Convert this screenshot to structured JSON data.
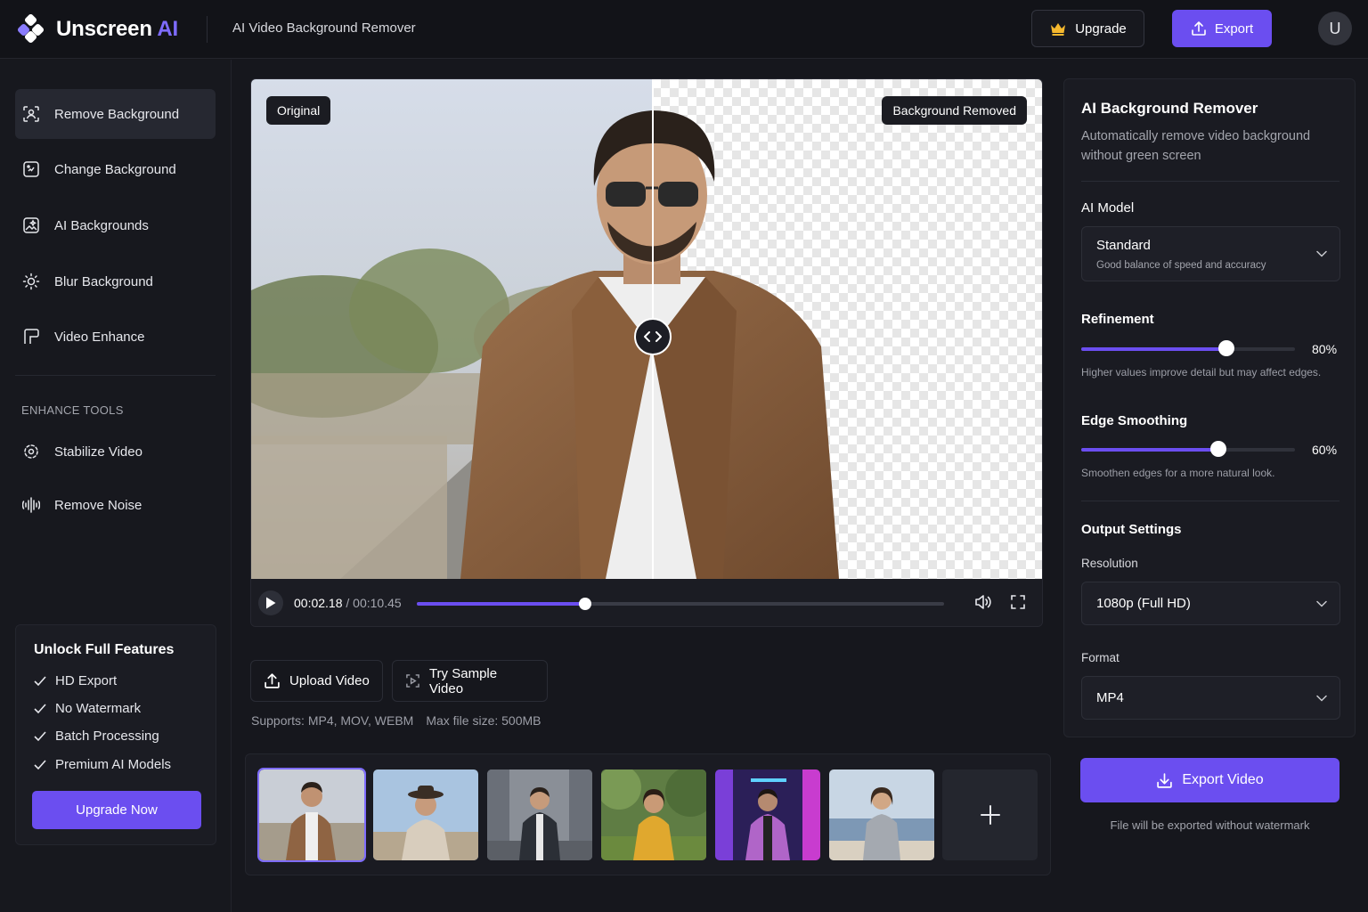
{
  "header": {
    "logo_name": "Unscreen ",
    "logo_ai": "AI",
    "page_title": "AI Video Background Remover",
    "upgrade_label": "Upgrade",
    "export_label": "Export",
    "avatar_initial": "U",
    "accent": "#6b4ef0"
  },
  "sidebar": {
    "items": [
      {
        "label": "Remove Background",
        "icon": "remove-bg-icon"
      },
      {
        "label": "Change Background",
        "icon": "change-bg-icon"
      },
      {
        "label": "AI Backgrounds",
        "icon": "ai-bg-icon"
      },
      {
        "label": "Blur Background",
        "icon": "blur-icon"
      },
      {
        "label": "Video Enhance",
        "icon": "enhance-icon"
      }
    ],
    "section_title": "ENHANCE TOOLS",
    "tools": [
      {
        "label": "Stabilize Video",
        "icon": "stabilize-icon"
      },
      {
        "label": "Remove Noise",
        "icon": "noise-icon"
      }
    ],
    "unlock": {
      "title": "Unlock Full Features",
      "features": [
        "HD Export",
        "No Watermark",
        "Batch Processing",
        "Premium AI Models"
      ],
      "button": "Upgrade Now"
    }
  },
  "preview": {
    "label_left": "Original",
    "label_right": "Background Removed",
    "current_time": "00:02.18",
    "separator": " / ",
    "total_time": "00:10.45",
    "progress": 0.32
  },
  "actions": {
    "upload_label": "Upload Video",
    "sample_label": "Try Sample Video",
    "supports": "Supports: MP4, MOV, WEBM",
    "max_size": "Max file size: 500MB"
  },
  "panel": {
    "title": "AI Background Remover",
    "description": "Automatically remove video background without green screen",
    "model_label": "AI Model",
    "model_value": "Standard",
    "model_sub": "Good balance of speed and accuracy",
    "refinement_label": "Refinement",
    "refinement_value": 80,
    "refinement_pct": "80%",
    "refinement_hint": "Higher values improve detail but may affect edges.",
    "smoothing_label": "Edge Smoothing",
    "smoothing_value": 60,
    "smoothing_pct": "60%",
    "smoothing_hint": "Smoothen edges for a more natural look.",
    "output_label": "Output Settings",
    "resolution_label": "Resolution",
    "resolution_value": "1080p (Full HD)",
    "format_label": "Format",
    "format_value": "MP4"
  },
  "export": {
    "button": "Export Video",
    "note": "File will be exported without watermark"
  }
}
